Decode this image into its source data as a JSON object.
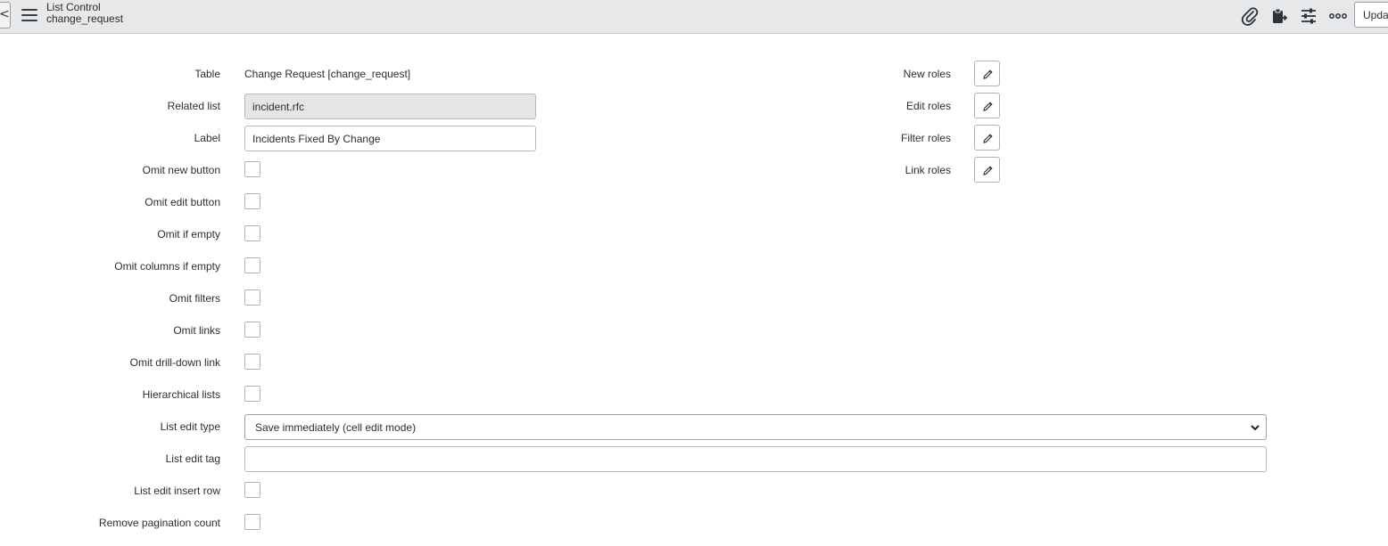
{
  "header": {
    "back_glyph": "<",
    "title": "List Control",
    "subtitle": "change_request",
    "update_label": "Updat",
    "icons": [
      "paperclip-icon",
      "clipboard-icon",
      "sliders-icon",
      "more-icon"
    ]
  },
  "form": {
    "table": {
      "label": "Table",
      "value": "Change Request [change_request]"
    },
    "related_list": {
      "label": "Related list",
      "value": "incident.rfc"
    },
    "label_field": {
      "label": "Label",
      "value": "Incidents Fixed By Change"
    },
    "checkboxes": [
      {
        "label": "Omit new button",
        "checked": false
      },
      {
        "label": "Omit edit button",
        "checked": false
      },
      {
        "label": "Omit if empty",
        "checked": false
      },
      {
        "label": "Omit columns if empty",
        "checked": false
      },
      {
        "label": "Omit filters",
        "checked": false
      },
      {
        "label": "Omit links",
        "checked": false
      },
      {
        "label": "Omit drill-down link",
        "checked": false
      },
      {
        "label": "Hierarchical lists",
        "checked": false
      }
    ],
    "list_edit_type": {
      "label": "List edit type",
      "value": "Save immediately (cell edit mode)"
    },
    "list_edit_tag": {
      "label": "List edit tag",
      "value": ""
    },
    "list_edit_insert_row": {
      "label": "List edit insert row",
      "checked": false
    },
    "remove_pagination_count": {
      "label": "Remove pagination count",
      "checked": false
    },
    "roles": [
      {
        "label": "New roles"
      },
      {
        "label": "Edit roles"
      },
      {
        "label": "Filter roles"
      },
      {
        "label": "Link roles"
      }
    ]
  },
  "colors": {
    "header_bg": "#e6e8ea",
    "readonly_bg": "#e4e5e6"
  }
}
